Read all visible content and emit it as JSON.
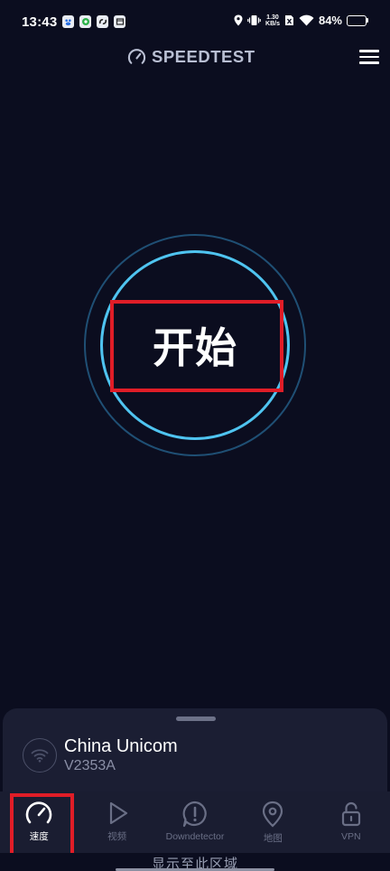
{
  "status_bar": {
    "time": "13:43",
    "net_speed_value": "1.30",
    "net_speed_unit": "KB/s",
    "battery": "84%",
    "battery_level": 0.84,
    "icons": [
      "baidu-app-icon",
      "browser-app-icon",
      "link-app-icon",
      "store-app-icon",
      "location-icon",
      "vibrate-icon",
      "network-speed-icon",
      "sim-x-icon",
      "wifi-icon",
      "battery-icon"
    ]
  },
  "header": {
    "title": "SPEEDTEST",
    "logo_icon": "speedometer-icon",
    "menu_icon": "hamburger-menu-icon"
  },
  "start": {
    "label": "开始",
    "ring_color": "#4fc4f0",
    "outer_ring_color": "#1f4f74"
  },
  "provider": {
    "name": "China Unicom",
    "server": "V2353A",
    "icon": "wifi-icon"
  },
  "nav": {
    "items": [
      {
        "label": "速度",
        "icon": "speedometer-icon",
        "active": true
      },
      {
        "label": "视频",
        "icon": "play-icon",
        "active": false
      },
      {
        "label": "Downdetector",
        "icon": "alert-icon",
        "active": false
      },
      {
        "label": "地图",
        "icon": "map-pin-icon",
        "active": false
      },
      {
        "label": "VPN",
        "icon": "unlock-icon",
        "active": false
      }
    ]
  },
  "gesture": {
    "text": "显示至此区域"
  },
  "colors": {
    "background": "#0b0d1f",
    "panel": "#1b1e33",
    "highlight": "#e01d27",
    "accent": "#4fc4f0"
  }
}
